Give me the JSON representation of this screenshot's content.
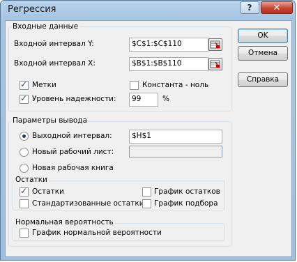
{
  "window": {
    "title": "Регрессия",
    "help": "?",
    "close": "✕"
  },
  "input": {
    "group_label": "Входные данные",
    "y_label": "Входной интервал Y:",
    "y_value": "$C$1:$C$110",
    "x_label": "Входной интервал X:",
    "x_value": "$B$1:$B$110",
    "labels_cb": "Метки",
    "labels_checked": true,
    "const_cb": "Константа - ноль",
    "const_checked": false,
    "conf_cb": "Уровень надежности:",
    "conf_checked": true,
    "conf_value": "99",
    "conf_unit": "%"
  },
  "output": {
    "group_label": "Параметры вывода",
    "range_label": "Выходной интервал:",
    "range_value": "$H$1",
    "range_selected": true,
    "sheet_label": "Новый рабочий лист:",
    "sheet_value": "",
    "book_label": "Новая рабочая книга"
  },
  "residuals": {
    "group_label": "Остатки",
    "residuals_cb": "Остатки",
    "residuals_checked": true,
    "std_cb": "Стандартизованные остатки",
    "plot_cb": "График остатков",
    "fit_cb": "График подбора"
  },
  "normal": {
    "group_label": "Нормальная вероятность",
    "plot_cb": "График нормальной вероятности"
  },
  "buttons": {
    "ok": "OK",
    "cancel": "Отмена",
    "help": "Справка"
  },
  "icons": {
    "range_picker": "range-picker-icon"
  },
  "colors": {
    "titlebar": "#a6c5e3",
    "close": "#c7432f",
    "face": "#f0f0f0"
  }
}
